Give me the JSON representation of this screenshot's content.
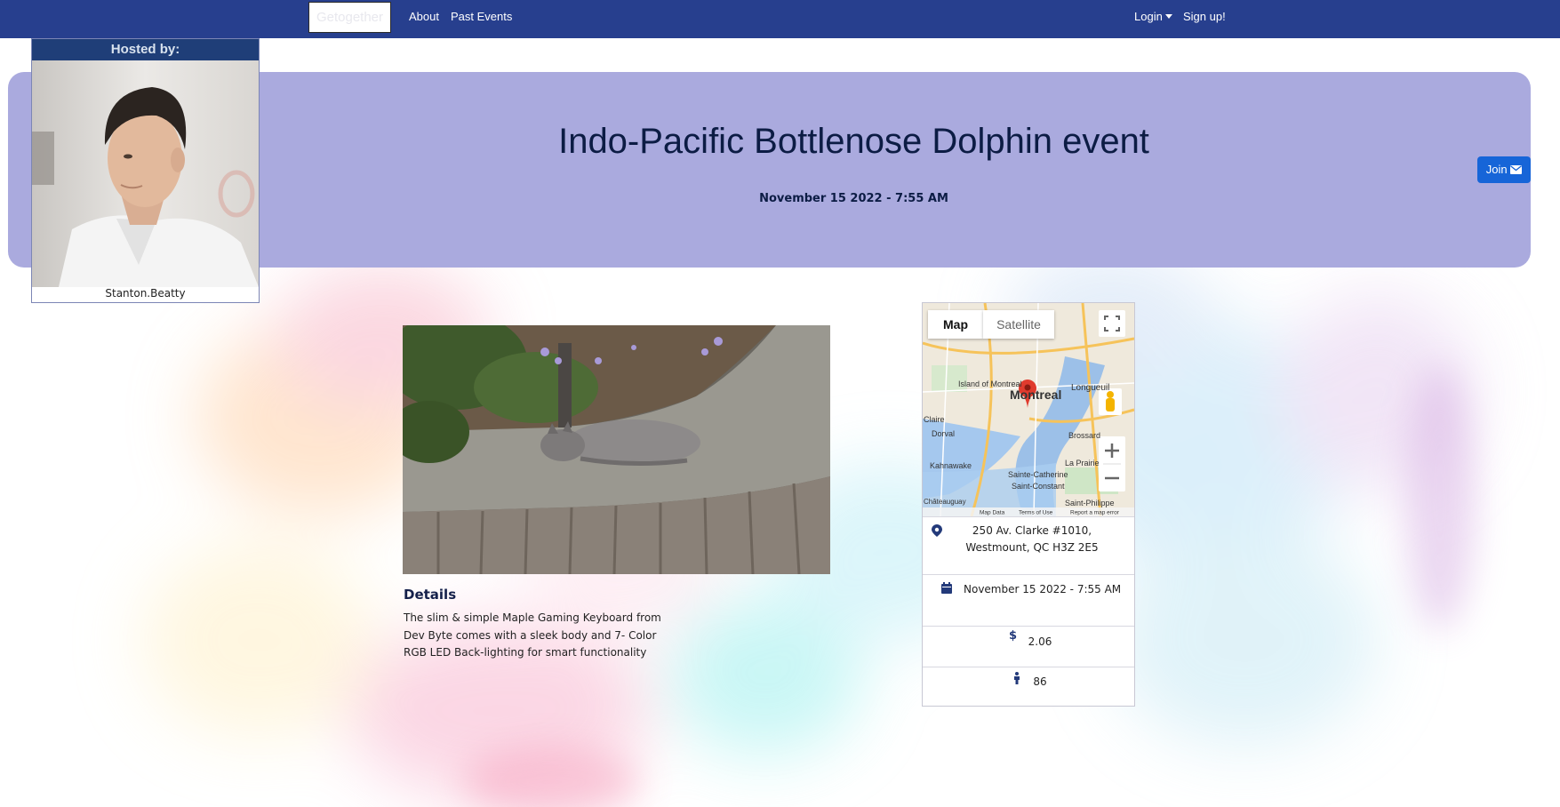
{
  "navbar": {
    "brand": "Getogether",
    "links": [
      "About",
      "Past Events"
    ],
    "login": "Login",
    "signup": "Sign up!"
  },
  "host": {
    "header": "Hosted by:",
    "name": "Stanton.Beatty"
  },
  "event": {
    "title": "Indo-Pacific Bottlenose Dolphin event",
    "date": "November 15 2022 - 7:55 AM",
    "join_label": "Join"
  },
  "details": {
    "title": "Details",
    "text": "The slim & simple Maple Gaming Keyboard from Dev Byte comes with a sleek body and 7- Color RGB LED Back-lighting for smart functionality"
  },
  "info": {
    "map_tab": "Map",
    "satellite_tab": "Satellite",
    "map_labels": [
      "Montreal",
      "Island of Montreal",
      "Longueuil",
      "Brossard",
      "La Prairie",
      "Kahnawake",
      "Sainte-Catherine",
      "Saint-Constant",
      "Dorval",
      "Claire",
      "Saint-Philippe",
      "Châteauguay"
    ],
    "map_footer": [
      "Map Data",
      "Terms of Use",
      "Report a map error"
    ],
    "address_line1": "250 Av. Clarke #1010,",
    "address_line2": "Westmount, QC H3Z 2E5",
    "date": "November 15 2022 - 7:55 AM",
    "price": "2.06",
    "capacity": "86"
  },
  "colors": {
    "navbar": "#273f8e",
    "hero": "#aaaade",
    "join": "#1665d8",
    "host_header": "#1f3e78"
  },
  "icons": [
    "map-marker-icon",
    "calendar-icon",
    "dollar-icon",
    "person-icon",
    "envelope-icon",
    "fullscreen-icon",
    "pegman-icon",
    "zoom-in-icon",
    "zoom-out-icon"
  ]
}
